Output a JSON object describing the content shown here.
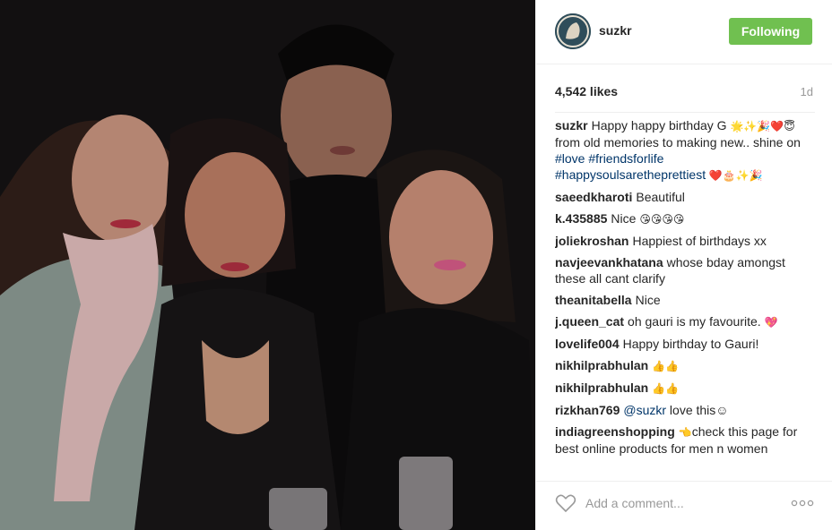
{
  "post": {
    "username": "suzkr",
    "follow_label": "Following",
    "likes": "4,542 likes",
    "time": "1d"
  },
  "comments": [
    {
      "user": "suzkr",
      "parts": [
        {
          "t": "Happy happy birthday G "
        },
        {
          "t": "🌟✨🎉❤️😇",
          "emo": true
        },
        {
          "t": "from old memories to making new.. shine on "
        },
        {
          "t": "#love",
          "tag": true
        },
        {
          "t": " "
        },
        {
          "t": "#friendsforlife",
          "tag": true
        },
        {
          "t": " "
        },
        {
          "t": "#happysoulsaretheprettiest",
          "tag": true
        },
        {
          "t": " ❤️🎂✨🎉",
          "emo": true
        }
      ]
    },
    {
      "user": "saeedkharoti",
      "parts": [
        {
          "t": "Beautiful"
        }
      ]
    },
    {
      "user": "k.435885",
      "parts": [
        {
          "t": "Nice "
        },
        {
          "t": "😘😘😘😘",
          "emo": true
        }
      ]
    },
    {
      "user": "joliekroshan",
      "parts": [
        {
          "t": "Happiest of birthdays xx"
        }
      ]
    },
    {
      "user": "navjeevankhatana",
      "parts": [
        {
          "t": "whose bday amongst these all cant clarify"
        }
      ]
    },
    {
      "user": "theanitabella",
      "parts": [
        {
          "t": "Nice"
        }
      ]
    },
    {
      "user": "j.queen_cat",
      "parts": [
        {
          "t": "oh gauri is my favourite. "
        },
        {
          "t": "💖",
          "emo": true
        }
      ]
    },
    {
      "user": "lovelife004",
      "parts": [
        {
          "t": "Happy birthday to Gauri!"
        }
      ]
    },
    {
      "user": "nikhilprabhulan",
      "parts": [
        {
          "t": "👍👍",
          "emo": true
        }
      ]
    },
    {
      "user": "nikhilprabhulan",
      "parts": [
        {
          "t": "👍👍",
          "emo": true
        }
      ]
    },
    {
      "user": "rizkhan769",
      "parts": [
        {
          "t": "@suzkr",
          "tag": true
        },
        {
          "t": " love this☺"
        }
      ]
    },
    {
      "user": "indiagreenshopping",
      "parts": [
        {
          "t": "👈",
          "emo": true
        },
        {
          "t": "check this page for best online products for men n women"
        }
      ]
    }
  ],
  "footer": {
    "comment_placeholder": "Add a comment...",
    "more_label": "ooo"
  },
  "icons": {
    "heart": "heart-outline-icon",
    "more": "more-options-icon"
  },
  "colors": {
    "follow_bg": "#70c050",
    "hashtag": "#003569",
    "muted": "#999999"
  }
}
